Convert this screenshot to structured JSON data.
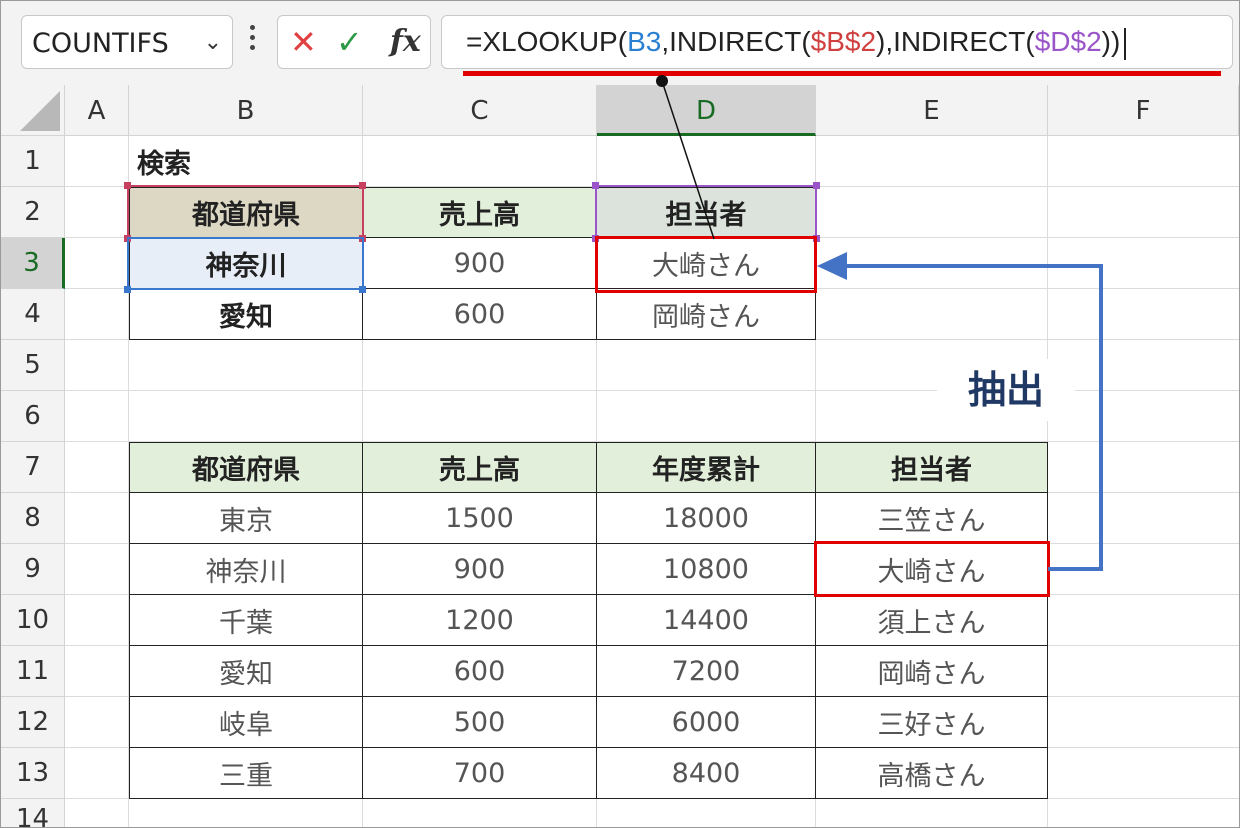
{
  "formula_bar": {
    "name_box": "COUNTIFS",
    "name_box_icon": "chevron-down-icon",
    "cancel_icon": "✕",
    "enter_icon": "✓",
    "fx_label": "fx",
    "formula": {
      "p1": "=XLOOKUP(",
      "ref1": "B3",
      "p2": ",INDIRECT(",
      "ref2": "$B$2",
      "p3": "),INDIRECT(",
      "ref3": "$D$2",
      "p4": "))"
    }
  },
  "columns": [
    "A",
    "B",
    "C",
    "D",
    "E",
    "F"
  ],
  "rows": [
    "1",
    "2",
    "3",
    "4",
    "5",
    "6",
    "7",
    "8",
    "9",
    "10",
    "11",
    "12",
    "13",
    "14"
  ],
  "active": {
    "column": "D",
    "row": "3"
  },
  "search_block": {
    "title": "検索",
    "headers": [
      "都道府県",
      "売上高",
      "担当者"
    ],
    "rows": [
      [
        "神奈川",
        "900",
        "大崎さん"
      ],
      [
        "愛知",
        "600",
        "岡崎さん"
      ]
    ]
  },
  "data_table": {
    "headers": [
      "都道府県",
      "売上高",
      "年度累計",
      "担当者"
    ],
    "rows": [
      [
        "東京",
        "1500",
        "18000",
        "三笠さん"
      ],
      [
        "神奈川",
        "900",
        "10800",
        "大崎さん"
      ],
      [
        "千葉",
        "1200",
        "14400",
        "須上さん"
      ],
      [
        "愛知",
        "600",
        "7200",
        "岡崎さん"
      ],
      [
        "岐阜",
        "500",
        "6000",
        "三好さん"
      ],
      [
        "三重",
        "700",
        "8400",
        "高橋さん"
      ]
    ]
  },
  "annotation": {
    "label": "抽出",
    "highlight_color": "#e00000",
    "arrow_color": "#4472c4"
  }
}
